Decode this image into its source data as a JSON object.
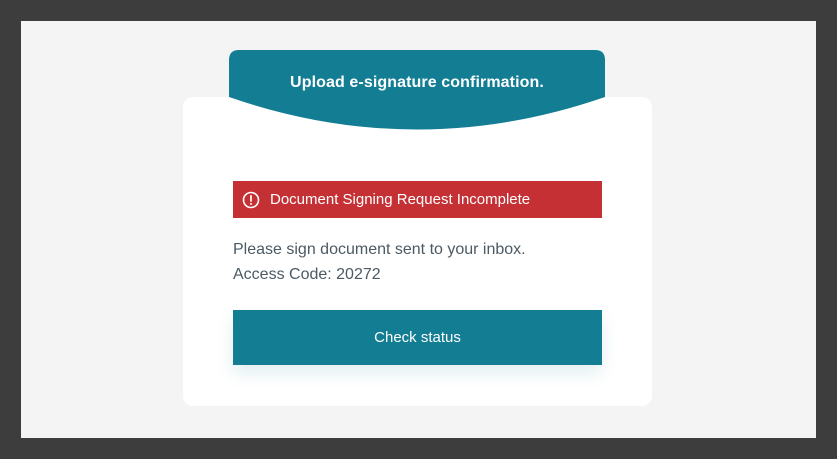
{
  "banner": {
    "title": "Upload e-signature confirmation."
  },
  "alert": {
    "icon": "alert-circle-icon",
    "text": "Document Signing Request Incomplete",
    "color": "#c53035"
  },
  "message": {
    "line1": "Please sign document sent to your inbox.",
    "line2": "Access Code: 20272"
  },
  "actions": {
    "check_status_label": "Check status"
  },
  "colors": {
    "accent": "#137d94",
    "frame": "#3d3d3d",
    "background": "#f4f4f4"
  }
}
